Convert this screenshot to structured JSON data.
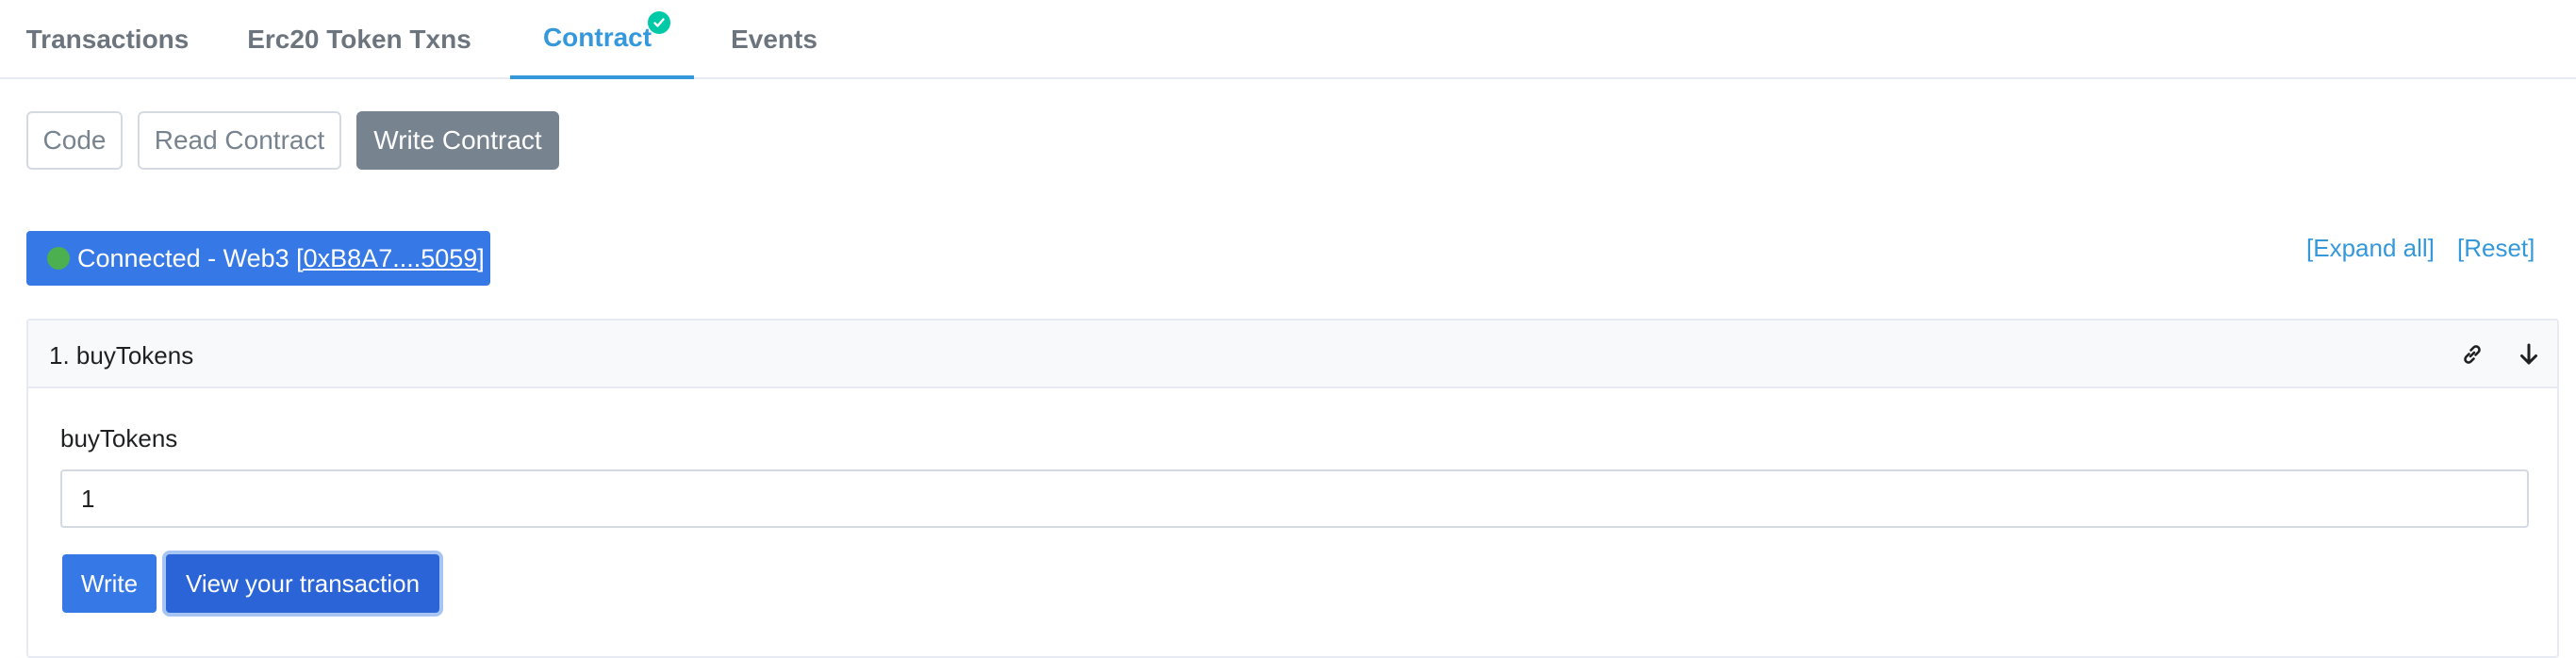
{
  "tabs": [
    {
      "label": "Transactions"
    },
    {
      "label": "Erc20 Token Txns"
    },
    {
      "label": "Contract",
      "active": true,
      "verified_icon": "check-circle-icon"
    },
    {
      "label": "Events"
    }
  ],
  "subnav": {
    "code_label": "Code",
    "read_label": "Read Contract",
    "write_label": "Write Contract"
  },
  "connection": {
    "status_text": "Connected - Web3 ",
    "address": "[0xB8A7....5059]",
    "status_color": "#4caf50"
  },
  "actions": {
    "expand_all": "[Expand all]",
    "reset": "[Reset]"
  },
  "method": {
    "title": "1. buyTokens",
    "link_icon": "link-icon",
    "expand_icon": "arrow-down-icon",
    "input_label": "buyTokens",
    "input_value": "1",
    "write_button": "Write",
    "view_tx_button": "View your transaction"
  },
  "colors": {
    "accent": "#3498db",
    "primary_button": "#3679e6",
    "verified": "#00c9a7",
    "muted": "#77838f"
  }
}
